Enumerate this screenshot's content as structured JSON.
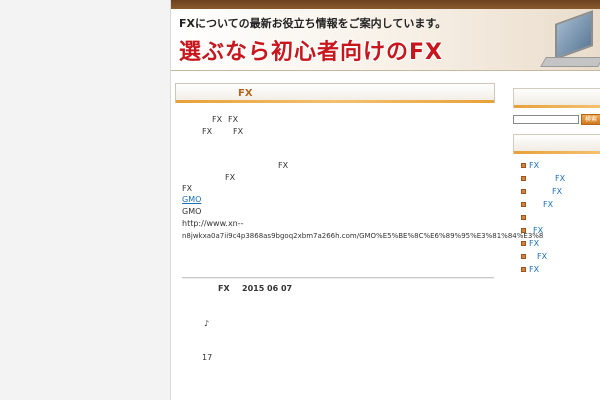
{
  "header": {
    "tagline": "FXについての最新お役立ち情報をご案内しています。",
    "title": "選ぶなら初心者向けのFX"
  },
  "main": {
    "section_title": "FX",
    "article": {
      "p1_a": "FX",
      "p1_b": "FX",
      "p2_a": "FX",
      "p2_b": "FX",
      "p3": "FX",
      "p4": "FX",
      "p5": "FX",
      "link_gmo": "GMO",
      "gmo_label": "GMO",
      "url_line1": "http://www.xn--",
      "url_line2": "n8jwkxa0a7ii9c4p3868as9bgoq2xbm7a266h.com/GMO%E5%BE%8C%E6%89%95%E3%81%84%E3%8"
    },
    "post": {
      "category": "FX",
      "date": "2015 06 07",
      "note": "♪",
      "number": "17"
    }
  },
  "sidebar": {
    "search_button": "検索",
    "items": [
      {
        "label": "FX"
      },
      {
        "label": "FX"
      },
      {
        "label": "FX"
      },
      {
        "label": "FX"
      },
      {
        "label": ""
      },
      {
        "label": "FX"
      },
      {
        "label": "FX"
      },
      {
        "label": "FX"
      },
      {
        "label": "FX"
      }
    ]
  }
}
